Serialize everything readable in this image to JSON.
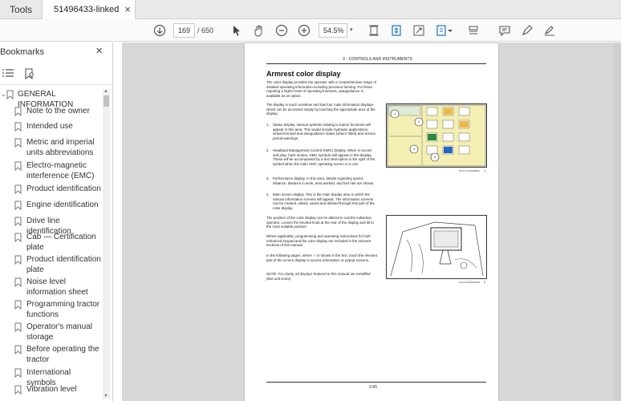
{
  "tabs": {
    "tools_label": "Tools",
    "doc_label": "51496433-linked pd...",
    "close_label": "×"
  },
  "toolbar": {
    "current_page": "169",
    "total_pages": "/ 650",
    "zoom": "54.5%",
    "zoom_caret": "▾"
  },
  "bookmarks": {
    "title": "Bookmarks",
    "close": "×",
    "scroll_up": "▲",
    "scroll_down": "▼",
    "head": {
      "caret": "⌄",
      "label": "GENERAL INFORMATION"
    },
    "items": [
      {
        "label": "Note to the owner"
      },
      {
        "label": "Intended use"
      },
      {
        "label": "Metric and imperial units abbreviations"
      },
      {
        "label": "Electro-magnetic interference (EMC)"
      },
      {
        "label": "Product identification"
      },
      {
        "label": "Engine identification"
      },
      {
        "label": "Drive line identification"
      },
      {
        "label": "Cab — Certification plate"
      },
      {
        "label": "Product identification plate"
      },
      {
        "label": "Noise level information sheet"
      },
      {
        "label": "Programming tractor functions"
      },
      {
        "label": "Operator's manual storage"
      },
      {
        "label": "Before operating the tractor"
      },
      {
        "label": "International symbols"
      },
      {
        "label": "Vibration level"
      }
    ]
  },
  "document": {
    "header": "3 - CONTROLS AND INSTRUMENTS",
    "title": "Armrest color display",
    "para1": "The color display provides the operator with a comprehensive range of detailed operating information including precision farming. For those requiring a higher level of operating functions, autoguidance is available as an option.",
    "para2": "The display is touch sensitive and has four main information displays which can be accessed simply by touching the appropriate area of the display.",
    "list": [
      {
        "n": "1.",
        "text": "Status display. Various symbols relating to tractor functions will appear in this area. This would include hydraulic applications, virtual terminal and autoguidance status (where fitted) and service period warnings."
      },
      {
        "n": "2.",
        "text": "Headland Management Control (HMC) Display. When in record and play- back modes, HMC symbols will appear in this display. These will be accompanied by a text description to the right of the symbol when the main HMC operating screen is in use."
      },
      {
        "n": "3.",
        "text": "Performance display. In this area, details regarding speed, distance, distance in work, area worked, and fuel rate are shown."
      },
      {
        "n": "4.",
        "text": "Main screen display. This is the main display area in which the various information screens will appear. The information screens can be created, edited, saved and deleted through this part of the color display."
      }
    ],
    "para3": "The position of the color display can be altered to suit the individual operator. Loosen the knurled knob at the rear of the display and tilt to the most suitable position.",
    "para4": "Where applicable, programming and operating instructions for both enhanced keypad and the color display are included in the relevant sections of this manual.",
    "para5": "In the following pages, where ☞ is shown in the text, touch the relevant part of the screen display to access information or popup screens.",
    "note": "NOTE: For clarity, all displays featured in this manual are mindifled (text and icons).",
    "fig1_caption": "SVIL17TR01098AA",
    "fig1_num": "1",
    "fig2_caption": "SVIL11TR00000AB",
    "fig2_num": "2",
    "fig1_callouts": [
      "1",
      "2",
      "3",
      "4"
    ],
    "page_number": "3-65"
  },
  "colors": {
    "panel_bg": "#d7d7d7",
    "screen_yellow": "#f4efb2",
    "accent": "#1a73c8"
  }
}
